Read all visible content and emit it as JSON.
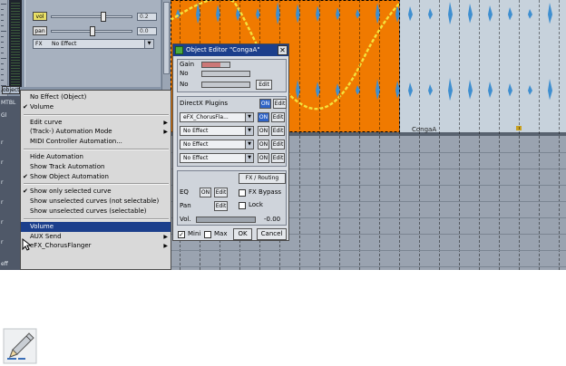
{
  "mixer": {
    "vol_label": "vol",
    "vol_value": "0.2",
    "pan_label": "pan",
    "pan_value": "0.0",
    "fx_label": "FX",
    "fx_value": "No Effect",
    "object_button": "object",
    "track_labels": [
      "MTBL",
      "Gl",
      "r",
      "r",
      "r",
      "r",
      "r",
      "r",
      "eff"
    ]
  },
  "timeline": {
    "clip_name": "CongaA",
    "clip_color": "#f07a00"
  },
  "context_menu": {
    "items": [
      {
        "label": "No Effect  (Object)",
        "check": false,
        "submenu": false
      },
      {
        "label": "Volume",
        "check": true,
        "submenu": false
      },
      {
        "separator": true
      },
      {
        "label": "Edit curve",
        "check": false,
        "submenu": true
      },
      {
        "label": "(Track-) Automation Mode",
        "check": false,
        "submenu": true
      },
      {
        "label": "MIDI Controller Automation...",
        "check": false,
        "submenu": false
      },
      {
        "separator": true
      },
      {
        "label": "Hide Automation",
        "check": false,
        "submenu": false
      },
      {
        "label": "Show Track Automation",
        "check": false,
        "submenu": false
      },
      {
        "label": "Show Object Automation",
        "check": true,
        "submenu": false
      },
      {
        "separator": true
      },
      {
        "label": "Show only selected curve",
        "check": true,
        "submenu": false
      },
      {
        "label": "Show unselected curves (not selectable)",
        "check": false,
        "submenu": false
      },
      {
        "label": "Show unselected curves (selectable)",
        "check": false,
        "submenu": false
      },
      {
        "separator": true
      },
      {
        "label": "Volume",
        "check": false,
        "submenu": false,
        "selected": true
      },
      {
        "label": "AUX Send",
        "check": false,
        "submenu": true
      },
      {
        "label": "eFX_ChorusFlanger",
        "check": false,
        "submenu": true
      }
    ]
  },
  "object_editor": {
    "title": "Object Editor \"CongaA\"",
    "gain_label": "Gain",
    "no1_label": "No",
    "no2_label": "No",
    "edit": "Edit",
    "on": "ON",
    "directx_label": "DirectX Plugins",
    "plugins": [
      "eFX_ChorusFla...",
      "No Effect",
      "No Effect",
      "No Effect"
    ],
    "fx_routing": "FX / Routing",
    "eq_label": "EQ",
    "fx_bypass": "FX Bypass",
    "pan_label": "Pan",
    "lock": "Lock",
    "vol_label": "Vol.",
    "vol_value": "-0.00",
    "mini": "Mini",
    "max": "Max",
    "ok": "OK",
    "cancel": "Cancel"
  },
  "tool_icon": "pencil-icon"
}
